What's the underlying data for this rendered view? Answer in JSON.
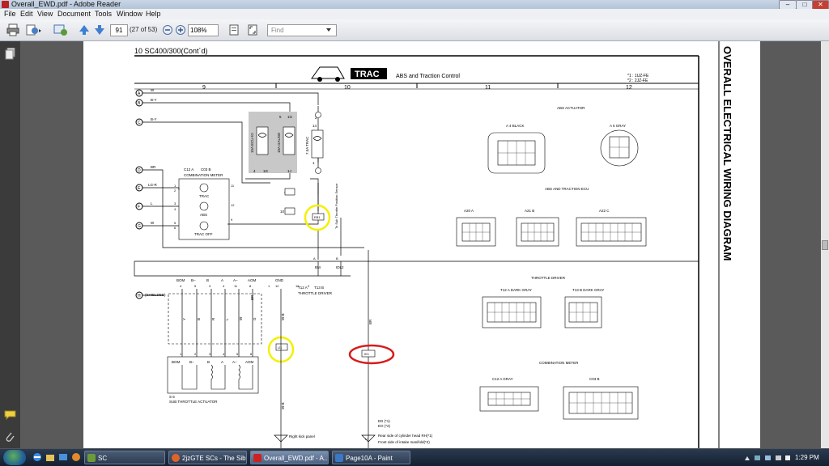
{
  "window": {
    "title": "Overall_EWD.pdf - Adobe Reader",
    "min": "–",
    "max": "□",
    "close": "✕"
  },
  "menu": [
    "File",
    "Edit",
    "View",
    "Document",
    "Tools",
    "Window",
    "Help"
  ],
  "toolbar": {
    "page_value": "91",
    "page_of": "(27 of 53)",
    "zoom_value": "108%",
    "find_placeholder": "Find",
    "icons": [
      "print-icon",
      "share-icon",
      "collaborate-icon",
      "prev-page-icon",
      "next-page-icon",
      "zoom-out-icon",
      "zoom-in-icon",
      "fit-page-icon",
      "fullscreen-icon"
    ]
  },
  "doc": {
    "header": "10 SC400/300(Cont´d)",
    "trac_logo": "TRAC",
    "section_title": "ABS and Traction Control",
    "notes": [
      "*1 : 1UZ-FE",
      "*2 : 2JZ-FE"
    ],
    "columns": [
      "9",
      "10",
      "11",
      "12"
    ],
    "side_title": "OVERALL ELECTRICAL WIRING DIAGRAM",
    "wire_letters": [
      "A",
      "B",
      "C",
      "D",
      "E",
      "F",
      "G",
      "H"
    ],
    "wire_colors": [
      "W",
      "B-Y",
      "B-Y",
      "BR",
      "LG-R",
      "L",
      "W"
    ],
    "fuses": [
      "15A ECU-IG",
      "10A GAUGE",
      "7.5A TRAC"
    ],
    "fuse_pins": [
      "5",
      "1G",
      "4",
      "1G",
      "1J",
      "2",
      "14",
      "1",
      "4",
      "2D",
      "10",
      "2D"
    ],
    "meter_labels": [
      "C12 A",
      "C03 B",
      "COMBINATION METER",
      "TRAC",
      "ABS",
      "TRAC OFF"
    ],
    "meter_pins": [
      "1",
      "2",
      "3",
      "4",
      "5",
      "6",
      "9",
      "11",
      "12"
    ],
    "connector_ids": [
      "EB1",
      "IJ1",
      "IK1"
    ],
    "sensor_note": "To Sub Throttle Position Sensor",
    "bus_labels": [
      "BM",
      "IDL2",
      "BOM",
      "B–",
      "B",
      "A",
      "A–",
      "AOM",
      "GND"
    ],
    "bus_pins": [
      "A",
      "B",
      "4",
      "5",
      "3",
      "4",
      "11",
      "8",
      "1",
      "12",
      "16",
      "2"
    ],
    "throttle_driver": [
      "T12 A",
      "T13 B",
      "THROTTLE DRIVER"
    ],
    "shielded": "(SHIELDED)",
    "lower_wire_colors": [
      "Y",
      "B",
      "R",
      "L",
      "W",
      "G",
      "BR",
      "W-B",
      "W-B",
      "BR"
    ],
    "actuator_pins": [
      "1",
      "2",
      "3",
      "4",
      "5",
      "6"
    ],
    "actuator_labels": [
      "BOM",
      "B–",
      "B",
      "A",
      "A–",
      "AOM"
    ],
    "actuator_name": [
      "S 6",
      "SUB THROTTLE ACTUATOR"
    ],
    "ground_labels": [
      "Right kick panel",
      "Rear side of cylinder head RH(*1)",
      "Front side of intake manifold(*2)"
    ],
    "ground_ids": [
      "ED (*1)",
      "EO (*2)"
    ],
    "ground_letter": "IJ",
    "panel_titles": [
      "ABS ACTUATOR",
      "ABS AND TRACTION ECU",
      "THROTTLE DRIVER",
      "COMBINATION METER"
    ],
    "panel_connectors": [
      "A 4  BLACK",
      "A 5  GRAY",
      "A20 A",
      "A21 B",
      "A22 C",
      "T12 A  DARK GRAY",
      "T13 B  DARK GRAY",
      "C12 A  GRAY",
      "C03 B"
    ]
  },
  "taskbar": {
    "items": [
      "SC",
      "2jzGTE SCs - The Sib...",
      "Overall_EWD.pdf - A...",
      "Page10A - Paint"
    ],
    "clock": "1:29 PM"
  },
  "colors": {
    "highlight_yellow": "#f4f000",
    "highlight_red": "#d81c1c",
    "fuse_box": "#c8c8c8"
  }
}
